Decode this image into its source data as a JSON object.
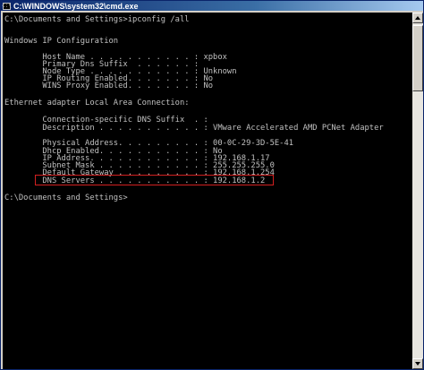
{
  "window": {
    "title": "C:\\WINDOWS\\system32\\cmd.exe",
    "icon_glyph": "c:\\"
  },
  "console": {
    "lines": [
      "C:\\Documents and Settings>ipconfig /all",
      "",
      "Windows IP Configuration",
      "",
      "        Host Name . . . . . . . . . . . : xpbox",
      "        Primary Dns Suffix  . . . . . . :",
      "        Node Type . . . . . . . . . . . : Unknown",
      "        IP Routing Enabled. . . . . . . : No",
      "        WINS Proxy Enabled. . . . . . . : No",
      "",
      "Ethernet adapter Local Area Connection:",
      "",
      "        Connection-specific DNS Suffix  . :",
      "        Description . . . . . . . . . . . : VMware Accelerated AMD PCNet Adapter",
      "",
      "        Physical Address. . . . . . . . . : 00-0C-29-3D-5E-41",
      "        Dhcp Enabled. . . . . . . . . . . : No",
      "        IP Address. . . . . . . . . . . . : 192.168.1.17",
      "        Subnet Mask . . . . . . . . . . . : 255.255.255.0",
      "        Default Gateway . . . . . . . . . : 192.168.1.254",
      "        DNS Servers . . . . . . . . . . . : 192.168.1.2",
      "",
      "C:\\Documents and Settings>"
    ]
  },
  "colors": {
    "console_background": "#000000",
    "console_text": "#c0c0c0",
    "highlight_border": "#d22020"
  }
}
